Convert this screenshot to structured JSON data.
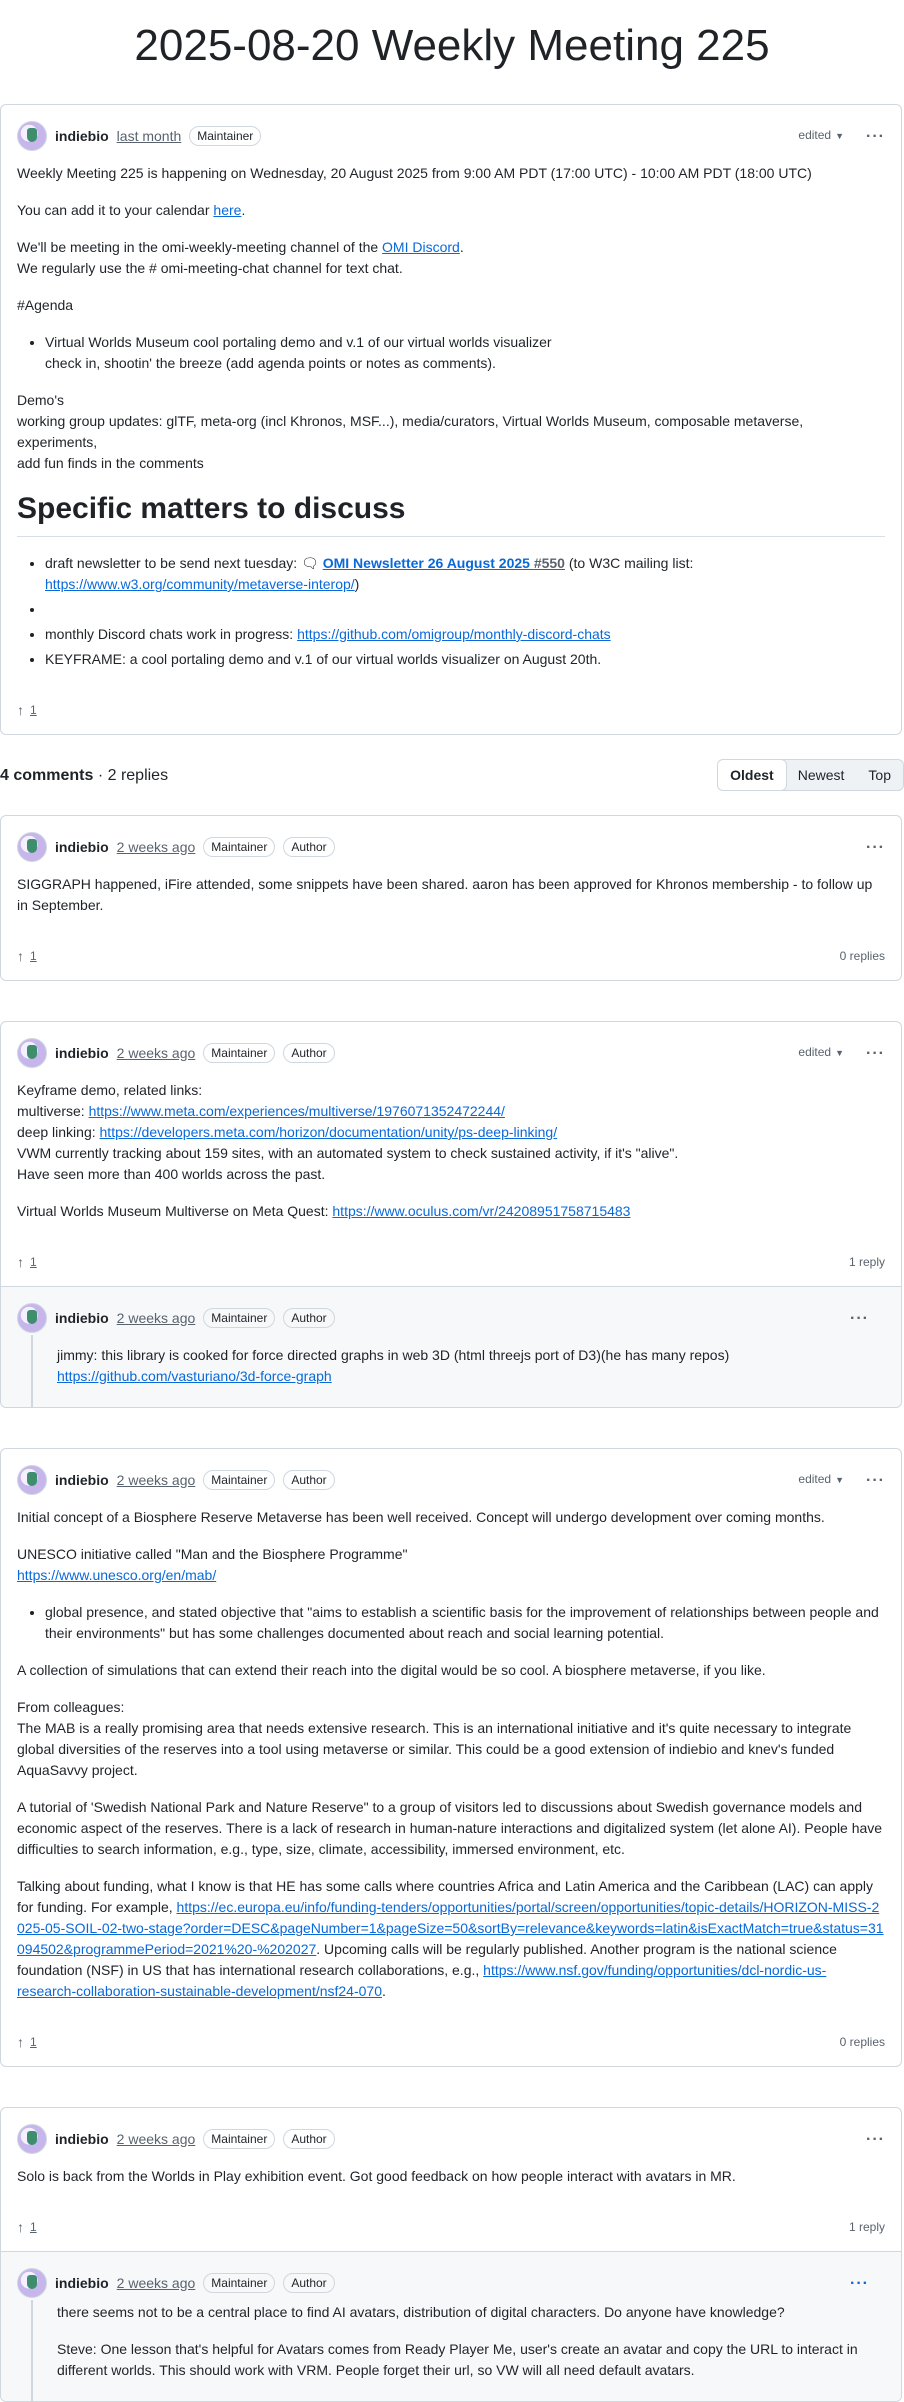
{
  "page": {
    "title": "2025-08-20 Weekly Meeting 225"
  },
  "post": {
    "author": "indiebio",
    "time": "last month",
    "badge_maintainer": "Maintainer",
    "edited": "edited",
    "p1": "Weekly Meeting 225 is happening on Wednesday, 20 August 2025 from 9:00 AM PDT (17:00 UTC) - 10:00 AM PDT (18:00 UTC)",
    "p2_text": "You can add it to your calendar ",
    "p2_link": "here",
    "p2_end": ".",
    "p3_text": "We'll be meeting in the omi-weekly-meeting channel of the ",
    "p3_link": "OMI Discord",
    "p3_end": ".",
    "p3_line2": "We regularly use the # omi-meeting-chat channel for text chat.",
    "agenda": "#Agenda",
    "agenda_item_line1": "Virtual Worlds Museum cool portaling demo and v.1 of our virtual worlds visualizer",
    "agenda_item_line2": "check in, shootin' the breeze (add agenda points or notes as comments).",
    "demos_l1": "Demo's",
    "demos_l2": "working group updates: glTF, meta-org (incl Khronos, MSF...), media/curators, Virtual Worlds Museum, composable metaverse, experiments,",
    "demos_l3": "add fun finds in the comments",
    "heading": "Specific matters to discuss",
    "m1_text": "draft newsletter to be send next tuesday: ",
    "m1_ref": "OMI Newsletter 26 August 2025",
    "m1_num": "#550",
    "m1_mid": " (to W3C mailing list: ",
    "m1_link": "https://www.w3.org/community/metaverse-interop/",
    "m1_end": ")",
    "m3_text": "monthly Discord chats work in progress: ",
    "m3_link": "https://github.com/omigroup/monthly-discord-chats",
    "m4": "KEYFRAME: a cool portaling demo and v.1 of our virtual worlds visualizer on August 20th.",
    "upvotes": "1"
  },
  "comments_header": {
    "count": "4 comments",
    "sep": " · ",
    "replies": "2 replies"
  },
  "sort_tabs": [
    "Oldest",
    "Newest",
    "Top"
  ],
  "c1": {
    "author": "indiebio",
    "time": "2 weeks ago",
    "badge1": "Maintainer",
    "badge2": "Author",
    "text": "SIGGRAPH happened, iFire attended, some snippets have been shared. aaron has been approved for Khronos membership - to follow up in September.",
    "upvotes": "1",
    "replies": "0 replies"
  },
  "c2": {
    "author": "indiebio",
    "time": "2 weeks ago",
    "badge1": "Maintainer",
    "badge2": "Author",
    "edited": "edited",
    "l1": "Keyframe demo, related links:",
    "l2_text": "multiverse: ",
    "l2_link": "https://www.meta.com/experiences/multiverse/1976071352472244/",
    "l3_text": "deep linking: ",
    "l3_link": "https://developers.meta.com/horizon/documentation/unity/ps-deep-linking/",
    "l4": "VWM currently tracking about 159 sites, with an automated system to check sustained activity, if it's \"alive\".",
    "l5": "Have seen more than 400 worlds across the past.",
    "p2_text": "Virtual Worlds Museum Multiverse on Meta Quest: ",
    "p2_link": "https://www.oculus.com/vr/24208951758715483",
    "upvotes": "1",
    "replies": "1 reply",
    "reply": {
      "author": "indiebio",
      "time": "2 weeks ago",
      "badge1": "Maintainer",
      "badge2": "Author",
      "text": "jimmy: this library is cooked for force directed graphs in web 3D (html threejs port of D3)(he has many repos)",
      "link": "https://github.com/vasturiano/3d-force-graph"
    }
  },
  "c3": {
    "author": "indiebio",
    "time": "2 weeks ago",
    "badge1": "Maintainer",
    "badge2": "Author",
    "edited": "edited",
    "p1": "Initial concept of a Biosphere Reserve Metaverse has been well received. Concept will undergo development over coming months.",
    "p2": "UNESCO initiative called \"Man and the Biosphere Programme\"",
    "p2_link": "https://www.unesco.org/en/mab/",
    "li1": "global presence, and stated objective that \"aims to establish a scientific basis for the improvement of relationships between people and their environments\" but has some challenges documented about reach and social learning potential.",
    "p3": "A collection of simulations that can extend their reach into the digital would be so cool. A biosphere metaverse, if you like.",
    "p4_l1": "From colleagues:",
    "p4_l2": "The MAB is a really promising area that needs extensive research. This is an international initiative and it's quite necessary to integrate global diversities of the reserves into a tool using metaverse or similar. This could be a good extension of indiebio and knev's funded AquaSavvy project.",
    "p5": "A tutorial of 'Swedish National Park and Nature Reserve\" to a group of visitors led to discussions about Swedish governance models and economic aspect of the reserves. There is a lack of research in human-nature interactions and digitalized system (let alone AI). People have difficulties to search information, e.g., type, size, climate, accessibility, immersed environment, etc.",
    "p6_a": "Talking about funding, what I know is that HE has some calls where countries Africa and Latin America and the Caribbean (LAC) can apply for funding. For example, ",
    "p6_link1": "https://ec.europa.eu/info/funding-tenders/opportunities/portal/screen/opportunities/topic-details/HORIZON-MISS-2025-05-SOIL-02-two-stage?order=DESC&pageNumber=1&pageSize=50&sortBy=relevance&keywords=latin&isExactMatch=true&status=31094502&programmePeriod=2021%20-%202027",
    "p6_b": ". Upcoming calls will be regularly published. Another program is the national science foundation (NSF) in US that has international research collaborations, e.g., ",
    "p6_link2": "https://www.nsf.gov/funding/opportunities/dcl-nordic-us-research-collaboration-sustainable-development/nsf24-070",
    "p6_c": ".",
    "upvotes": "1",
    "replies": "0 replies"
  },
  "c4": {
    "author": "indiebio",
    "time": "2 weeks ago",
    "badge1": "Maintainer",
    "badge2": "Author",
    "text": "Solo is back from the Worlds in Play exhibition event. Got good feedback on how people interact with avatars in MR.",
    "upvotes": "1",
    "replies": "1 reply",
    "reply": {
      "author": "indiebio",
      "time": "2 weeks ago",
      "badge1": "Maintainer",
      "badge2": "Author",
      "p1": "there seems not to be a central place to find AI avatars, distribution of digital characters. Do anyone have knowledge?",
      "p2": "Steve: One lesson that's helpful for Avatars comes from Ready Player Me, user's create an avatar and copy the URL to interact in different worlds. This should work with VRM. People forget their url, so VW will all need default avatars."
    }
  },
  "colors": {
    "link": "#0969da",
    "border": "#d0d7de",
    "muted": "#59636e",
    "reply_bg": "#f6f8fa"
  },
  "icons": [
    "upvote-arrow-icon",
    "kebab-menu-icon",
    "chevron-down-icon",
    "discussion-icon",
    "avatar"
  ]
}
